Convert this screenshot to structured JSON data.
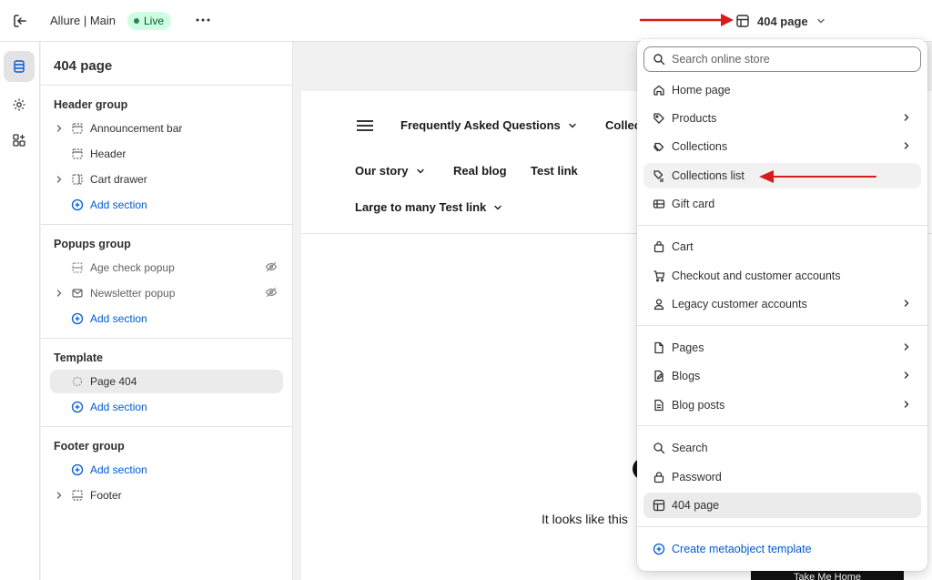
{
  "topbar": {
    "store_name": "Allure | Main",
    "status_badge": "Live",
    "current_page": "404 page"
  },
  "sidebar": {
    "title": "404 page",
    "groups": [
      {
        "title": "Header group",
        "items": [
          {
            "label": "Announcement bar",
            "icon": "section-icon",
            "expandable": true
          },
          {
            "label": "Header",
            "icon": "header-section-icon",
            "expandable": false
          },
          {
            "label": "Cart drawer",
            "icon": "drawer-icon",
            "expandable": true
          }
        ],
        "add_label": "Add section"
      },
      {
        "title": "Popups group",
        "items": [
          {
            "label": "Age check popup",
            "icon": "popup-icon",
            "expandable": false,
            "hidden": true
          },
          {
            "label": "Newsletter popup",
            "icon": "email-icon",
            "expandable": true,
            "hidden": true
          }
        ],
        "add_label": "Add section"
      },
      {
        "title": "Template",
        "items": [
          {
            "label": "Page 404",
            "icon": "placeholder-icon",
            "expandable": false,
            "selected": true
          }
        ],
        "add_label": "Add section"
      },
      {
        "title": "Footer group",
        "add_label": "Add section",
        "items": [
          {
            "label": "Footer",
            "icon": "footer-icon",
            "expandable": true
          }
        ]
      }
    ]
  },
  "preview": {
    "nav": [
      "Frequently Asked Questions",
      "Collec",
      "Our story",
      "Real blog",
      "Test link",
      "Large to many Test link"
    ],
    "not_found_text": "It looks like this",
    "cta": "Take Me Home"
  },
  "dropdown": {
    "search_placeholder": "Search online store",
    "items": [
      {
        "label": "Home page",
        "icon": "home-icon"
      },
      {
        "label": "Products",
        "icon": "tag-icon",
        "submenu": true
      },
      {
        "label": "Collections",
        "icon": "collection-icon",
        "submenu": true
      },
      {
        "label": "Collections list",
        "icon": "collection-list-icon",
        "highlighted": true
      },
      {
        "label": "Gift card",
        "icon": "gift-card-icon"
      },
      {
        "label": "Cart",
        "icon": "bag-icon"
      },
      {
        "label": "Checkout and customer accounts",
        "icon": "cart-icon"
      },
      {
        "label": "Legacy customer accounts",
        "icon": "person-icon",
        "submenu": true
      },
      {
        "label": "Pages",
        "icon": "page-icon",
        "submenu": true
      },
      {
        "label": "Blogs",
        "icon": "blog-icon",
        "submenu": true
      },
      {
        "label": "Blog posts",
        "icon": "blog-post-icon",
        "submenu": true
      },
      {
        "label": "Search",
        "icon": "search-icon"
      },
      {
        "label": "Password",
        "icon": "lock-icon"
      },
      {
        "label": "404 page",
        "icon": "layout-icon",
        "selected": true
      },
      {
        "label": "Create metaobject template",
        "icon": "plus-circle-icon"
      }
    ]
  },
  "colors": {
    "accent_blue": "#005bd3",
    "live_green_bg": "#cdfee1",
    "annotation_red": "#d61c1c"
  }
}
